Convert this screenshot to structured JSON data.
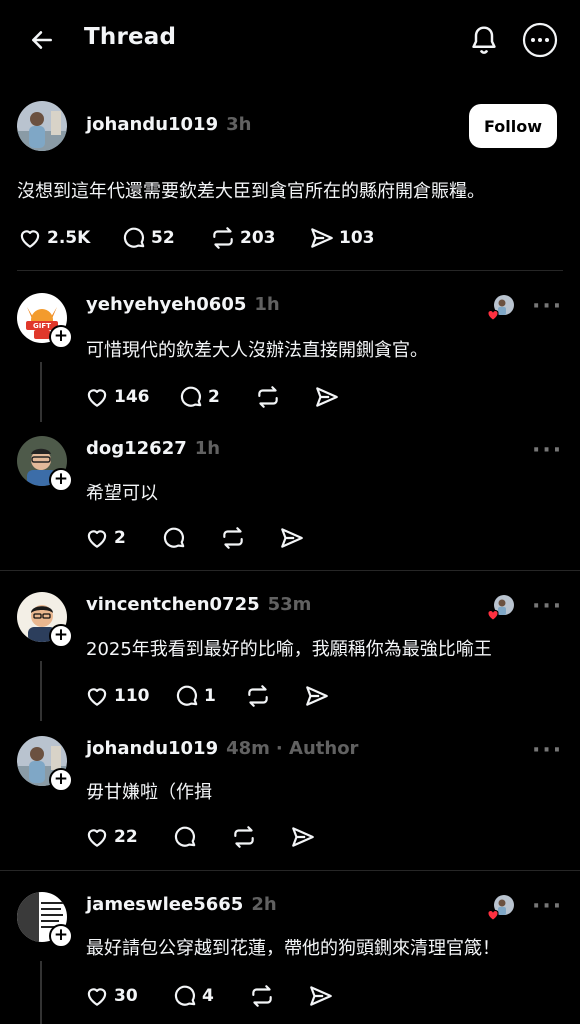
{
  "header": {
    "title": "Thread"
  },
  "main_post": {
    "username": "johandu1019",
    "time": "3h",
    "follow_label": "Follow",
    "text": "沒想到這年代還需要欽差大臣到貪官所在的縣府開倉賑糧。",
    "likes": "2.5K",
    "comments": "52",
    "reposts": "203",
    "shares": "103"
  },
  "replies": [
    {
      "username": "yehyehyeh0605",
      "time": "1h",
      "text": "可惜現代的欽差大人沒辦法直接開鍘貪官。",
      "likes": "146",
      "comments": "2",
      "reposts": "",
      "shares": ""
    },
    {
      "username": "dog12627",
      "time": "1h",
      "text": "希望可以",
      "likes": "2",
      "comments": "",
      "reposts": "",
      "shares": ""
    },
    {
      "username": "vincentchen0725",
      "time": "53m",
      "text": "2025年我看到最好的比喻，我願稱你為最強比喻王",
      "likes": "110",
      "comments": "1",
      "reposts": "",
      "shares": ""
    },
    {
      "username": "johandu1019",
      "time": "48m",
      "author_tag": "· Author",
      "text": "毋甘嫌啦（作揖",
      "likes": "22",
      "comments": "",
      "reposts": "",
      "shares": ""
    },
    {
      "username": "jameswlee5665",
      "time": "2h",
      "text": "最好請包公穿越到花蓮，帶他的狗頭鍘來清理官箴！",
      "likes": "30",
      "comments": "4",
      "reposts": "",
      "shares": ""
    }
  ],
  "colors": {
    "background": "#000000",
    "text": "#f3f5f7",
    "muted": "#616161",
    "like_red": "#ff3040"
  }
}
